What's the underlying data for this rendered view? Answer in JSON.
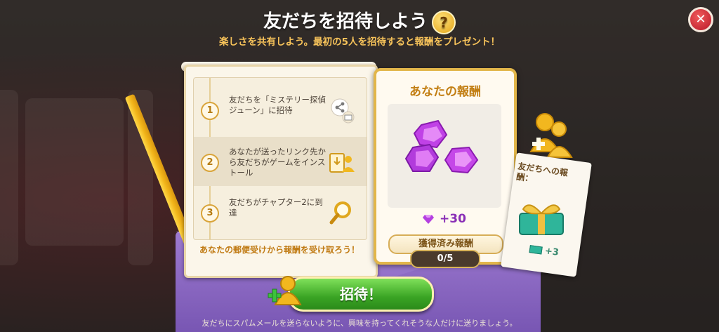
{
  "header": {
    "title": "友だちを招待しよう",
    "help_glyph": "?",
    "subtitle": "楽しさを共有しよう。最初の5人を招待すると報酬をプレゼント！",
    "close_glyph": "✕"
  },
  "steps": [
    {
      "num": "1",
      "text": "友だちを「ミステリー探偵ジューン」に招待",
      "icon": "share-icon"
    },
    {
      "num": "2",
      "text": "あなたが送ったリンク先から友だちがゲームをインストール",
      "icon": "install-icon"
    },
    {
      "num": "3",
      "text": "友だちがチャプター2に到達",
      "icon": "magnifier-icon"
    }
  ],
  "scroll_footer": "あなたの郵便受けから報酬を受け取ろう！",
  "reward": {
    "title": "あなたの報酬",
    "amount": "+30",
    "claimed_label": "獲得済み報酬",
    "progress": "0/5",
    "progress_value": 0,
    "progress_max": 5
  },
  "friend_reward": {
    "label": "友だちへの報酬：",
    "amount": "+3"
  },
  "invite_button": "招待！",
  "footnote": "友だちにスパムメールを送らないように、興味を持ってくれそうな人だけに送りましょう。",
  "colors": {
    "accent_gold": "#e2b64a",
    "gem_purple": "#b43fe0",
    "invite_green": "#3aa424",
    "close_red": "#c91f2e"
  }
}
